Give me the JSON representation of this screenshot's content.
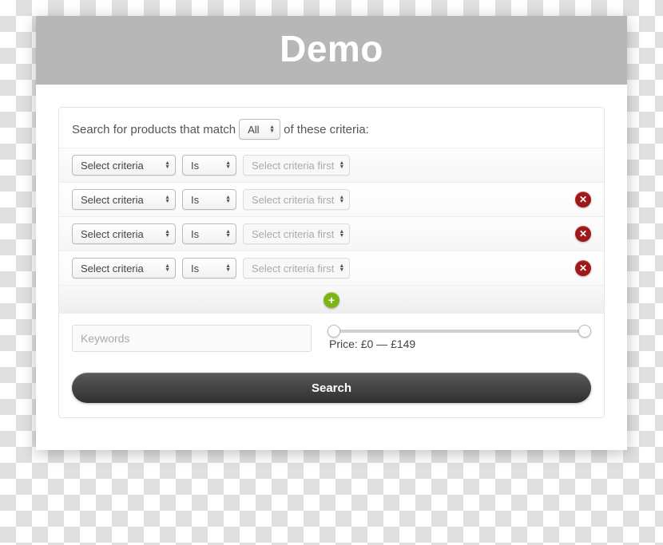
{
  "header": {
    "title": "Demo"
  },
  "intro": {
    "prefix": "Search for products that match",
    "match_mode": "All",
    "suffix": "of these criteria:"
  },
  "rows": [
    {
      "criteria": "Select criteria",
      "op": "Is",
      "value": "Select criteria first",
      "removable": false
    },
    {
      "criteria": "Select criteria",
      "op": "Is",
      "value": "Select criteria first",
      "removable": true
    },
    {
      "criteria": "Select criteria",
      "op": "Is",
      "value": "Select criteria first",
      "removable": true
    },
    {
      "criteria": "Select criteria",
      "op": "Is",
      "value": "Select criteria first",
      "removable": true
    }
  ],
  "keywords": {
    "placeholder": "Keywords",
    "value": ""
  },
  "price": {
    "label_prefix": "Price: ",
    "currency": "£",
    "min": 0,
    "max": 149,
    "range_min": 0,
    "range_max": 149
  },
  "buttons": {
    "add": "+",
    "remove": "✕",
    "search": "Search"
  }
}
